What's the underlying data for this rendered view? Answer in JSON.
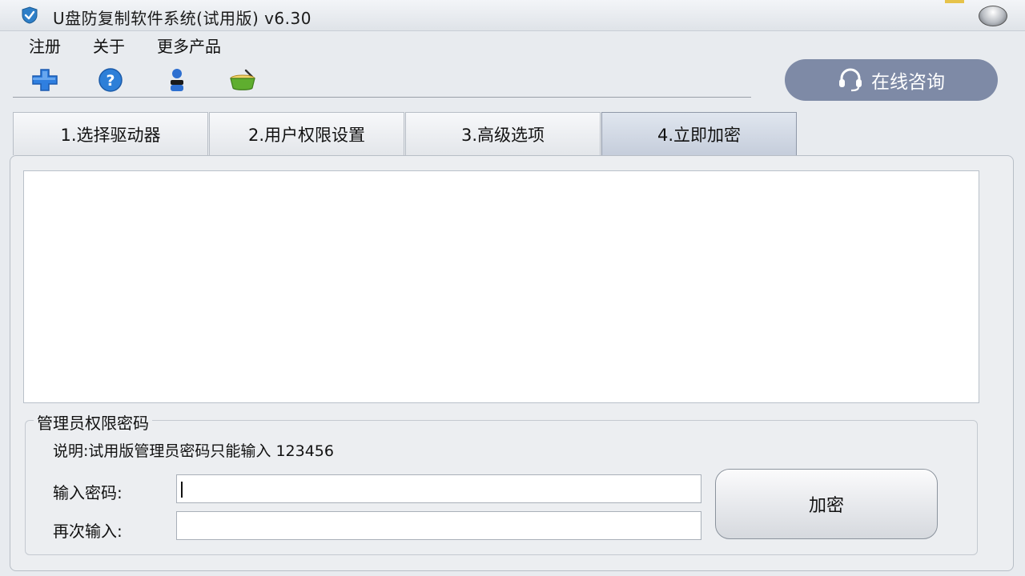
{
  "window": {
    "title": "U盘防复制软件系统(试用版) v6.30"
  },
  "menu": [
    "注册",
    "关于",
    "更多产品"
  ],
  "toolbar": {
    "icons": [
      "plus-icon",
      "help-icon",
      "user-icon",
      "basket-icon"
    ],
    "consult_label": "在线咨询"
  },
  "tabs": [
    "1.选择驱动器",
    "2.用户权限设置",
    "3.高级选项",
    "4.立即加密"
  ],
  "active_tab": 3,
  "admin": {
    "group_title": "管理员权限密码",
    "note": "说明:试用版管理员密码只能输入 123456",
    "password_label": "输入密码:",
    "password_value": "",
    "confirm_label": "再次输入:",
    "confirm_value": "",
    "encrypt_label": "加密"
  },
  "colors": {
    "consult_bg": "#7e8aa6",
    "plus_icon": "#2f7fe0",
    "help_icon": "#2d7fd8",
    "basket_icon": "#5fae2f"
  }
}
